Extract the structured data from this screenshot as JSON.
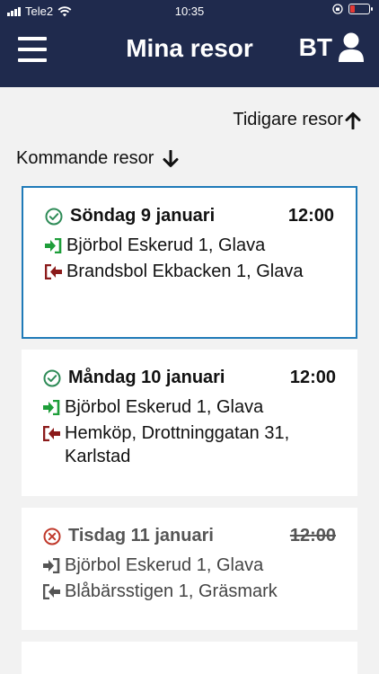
{
  "status_bar": {
    "carrier": "Tele2",
    "time": "10:35"
  },
  "header": {
    "title": "Mina resor",
    "user_initials": "BT",
    "icons": {
      "menu": "hamburger-menu-icon",
      "user": "user-icon"
    }
  },
  "earlier_trips_label": "Tidigare resor",
  "upcoming_trips_label": "Kommande resor",
  "colors": {
    "header_bg": "#1f2a4d",
    "selected_border": "#1f7ab8",
    "pickup_green": "#1e9e3a",
    "dropoff_red": "#8b1a1a",
    "confirmed_green": "#2e8b57",
    "cancelled_red": "#c0392b"
  },
  "trips": [
    {
      "date": "Söndag 9 januari",
      "time": "12:00",
      "status": "confirmed",
      "from": "Björbol Eskerud 1, Glava",
      "to": "Brandsbol Ekbacken 1, Glava"
    },
    {
      "date": "Måndag 10 januari",
      "time": "12:00",
      "status": "confirmed",
      "from": "Björbol Eskerud 1, Glava",
      "to": "Hemköp, Drottninggatan 31, Karlstad"
    },
    {
      "date": "Tisdag 11 januari",
      "time": "12:00",
      "status": "cancelled",
      "from": "Björbol Eskerud 1, Glava",
      "to": "Blåbärsstigen 1, Gräsmark"
    }
  ]
}
